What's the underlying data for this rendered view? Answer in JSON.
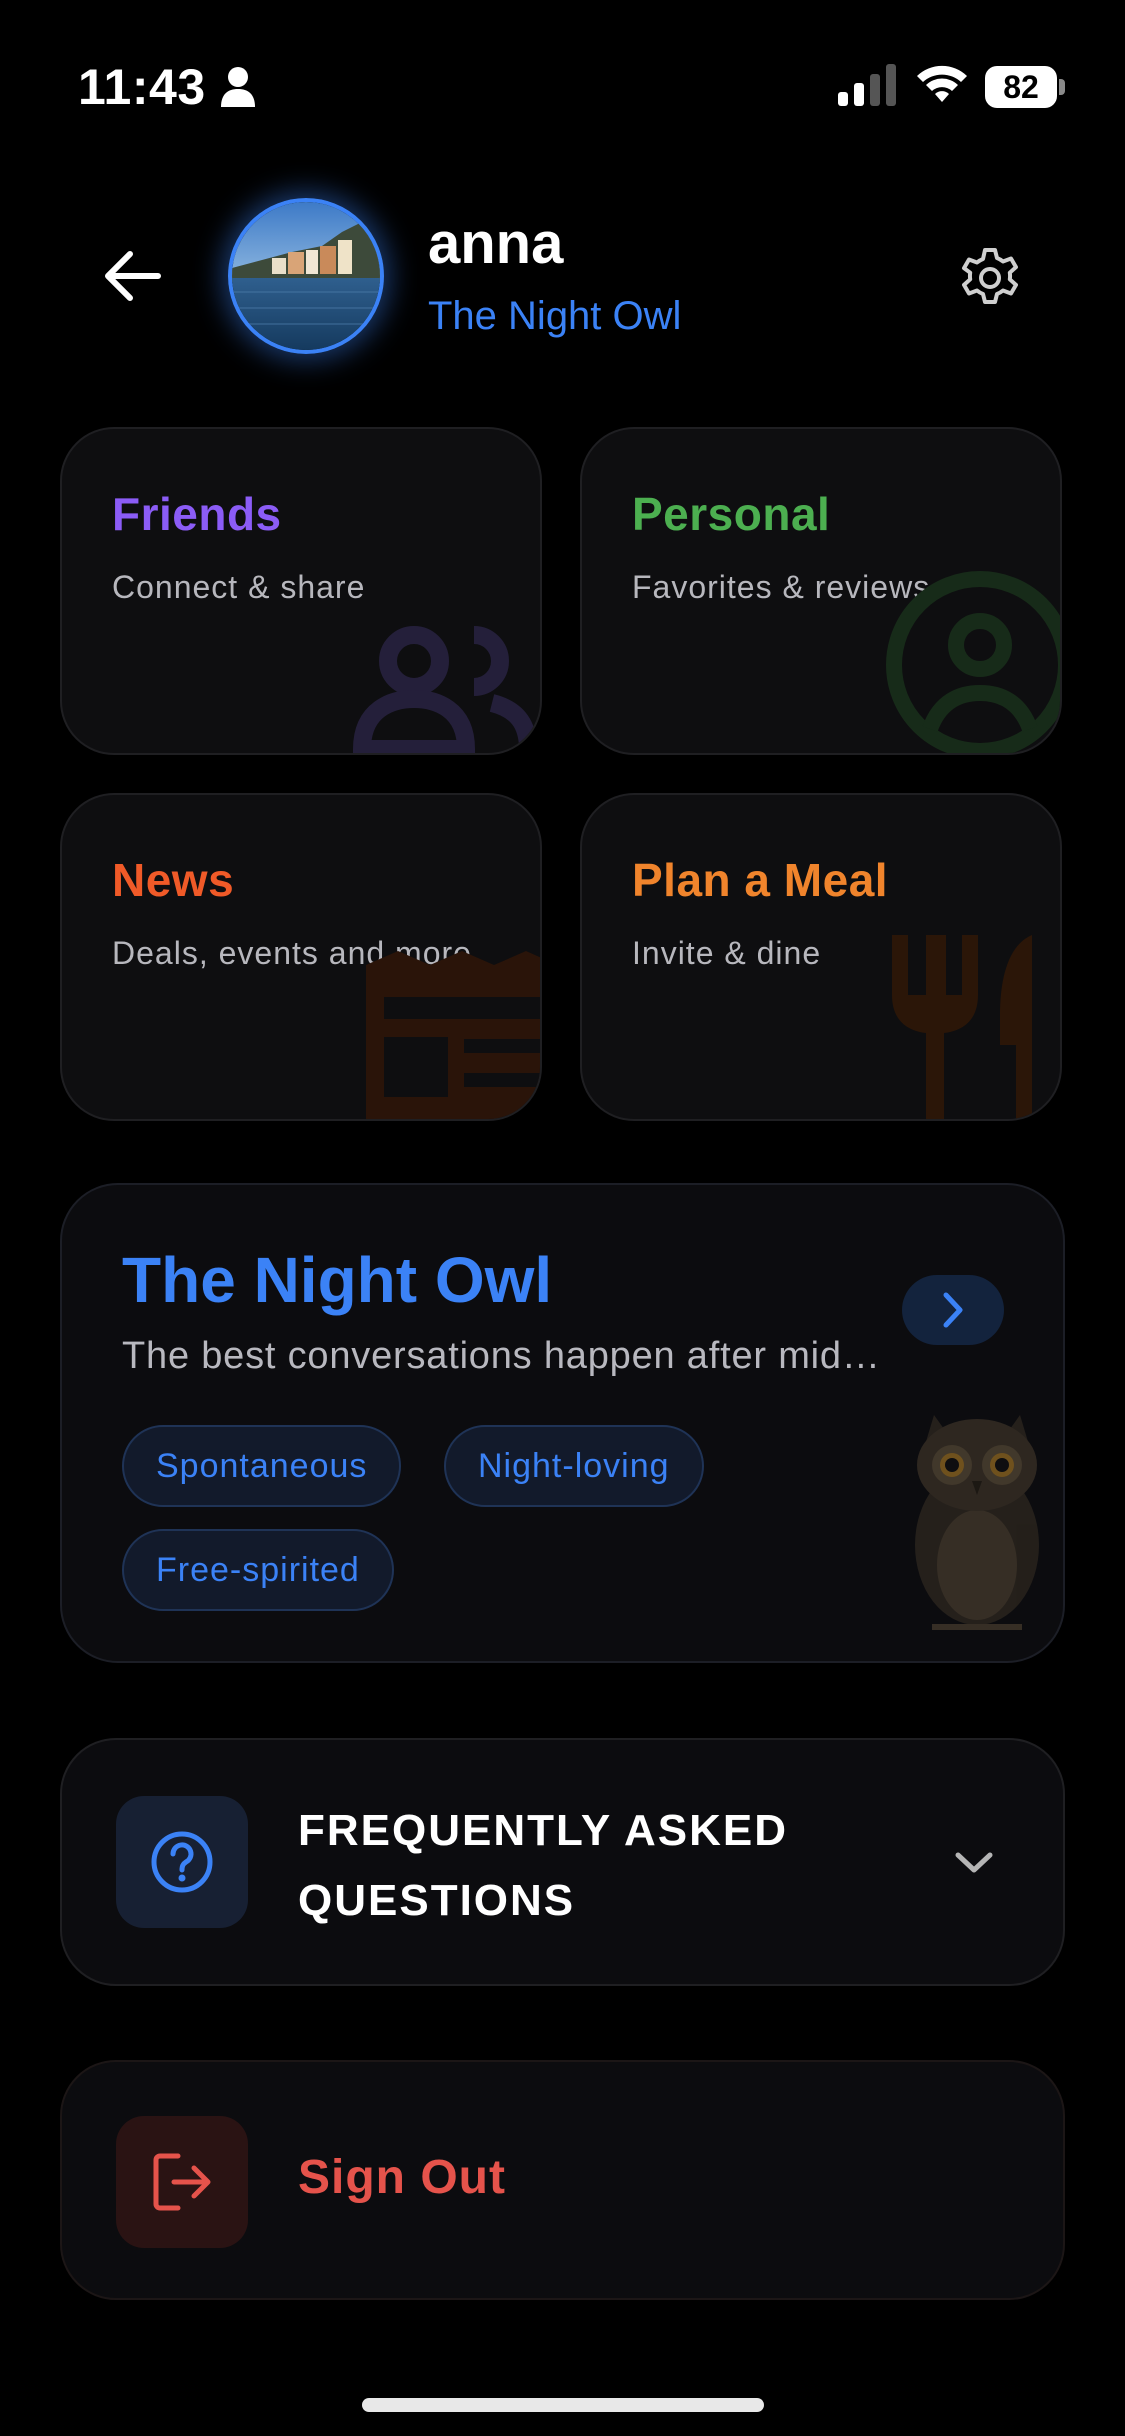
{
  "status_bar": {
    "time": "11:43",
    "battery": "82"
  },
  "header": {
    "name": "anna",
    "persona": "The Night Owl"
  },
  "tiles": [
    {
      "title": "Friends",
      "subtitle": "Connect & share",
      "color": "#8b5cf6"
    },
    {
      "title": "Personal",
      "subtitle": "Favorites & reviews",
      "color": "#4caf50"
    },
    {
      "title": "News",
      "subtitle": "Deals, events and more",
      "color": "#f05a28"
    },
    {
      "title": "Plan a Meal",
      "subtitle": "Invite & dine",
      "color": "#f0842c"
    }
  ],
  "persona_card": {
    "title": "The Night Owl",
    "description": "The best conversations happen after midnight",
    "tags": [
      "Spontaneous",
      "Night-loving",
      "Free-spirited"
    ],
    "accent": "#3b82f6"
  },
  "faq": {
    "label": "FREQUENTLY ASKED QUESTIONS"
  },
  "sign_out": {
    "label": "Sign Out",
    "color": "#e5534b"
  }
}
